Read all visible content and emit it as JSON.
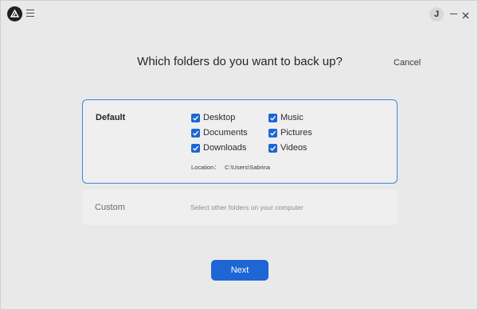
{
  "titlebar": {
    "avatar_initial": "J"
  },
  "main": {
    "heading": "Which folders do you want to back up?",
    "cancel_label": "Cancel"
  },
  "default_card": {
    "label": "Default",
    "folders": [
      {
        "label": "Desktop",
        "checked": true
      },
      {
        "label": "Music",
        "checked": true
      },
      {
        "label": "Documents",
        "checked": true
      },
      {
        "label": "Pictures",
        "checked": true
      },
      {
        "label": "Downloads",
        "checked": true
      },
      {
        "label": "Videos",
        "checked": true
      }
    ],
    "location_label": "Location：",
    "location_path": "C:\\Users\\Sabrina"
  },
  "custom_card": {
    "label": "Custom",
    "description": "Select other folders on your computer"
  },
  "footer": {
    "next_label": "Next"
  },
  "colors": {
    "accent": "#1d66d4",
    "card_border": "#3a86d8",
    "background": "#e9e9ea"
  }
}
